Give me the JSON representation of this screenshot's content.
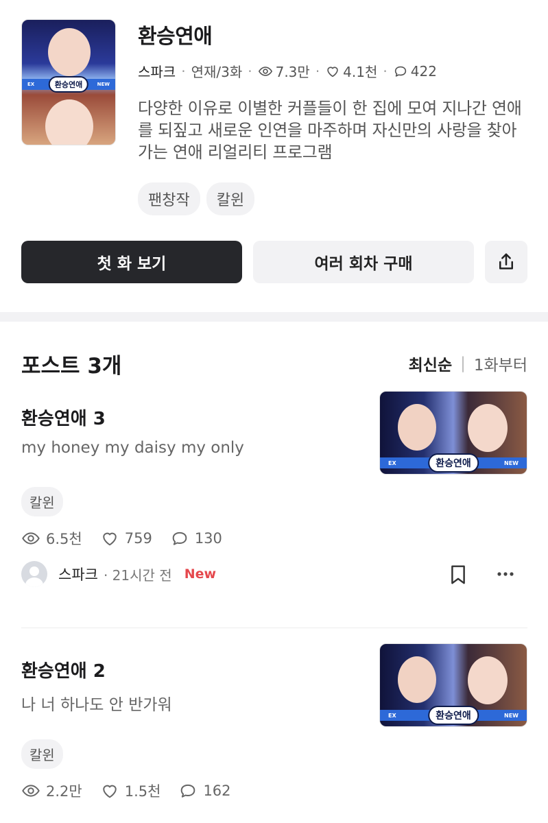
{
  "series": {
    "title": "환승연애",
    "author": "스파크",
    "status": "연재/3화",
    "views": "7.3만",
    "likes": "4.1천",
    "comments": "422",
    "description": "다양한 이유로 이별한 커플들이 한 집에 모여 지나간 연애를 되짚고 새로운 인연을 마주하며 자신만의 사랑을 찾아가는 연애 리얼리티 프로그램",
    "tags": [
      "팬창작",
      "칼윈"
    ],
    "cover_logo": "환승연애",
    "cover_band_left": "EX",
    "cover_band_right": "NEW"
  },
  "actions": {
    "first_episode": "첫 화 보기",
    "buy_multiple": "여러 회차 구매",
    "share_icon": "share-icon"
  },
  "posts_section": {
    "title": "포스트 3개",
    "sort_latest": "최신순",
    "sort_from_first": "1화부터"
  },
  "posts": [
    {
      "title": "환승연애 3",
      "subtitle": "my honey my daisy my only",
      "tag": "칼윈",
      "views": "6.5천",
      "likes": "759",
      "comments": "130",
      "author": "스파크",
      "time": "· 21시간 전",
      "badge": "New",
      "thumb_logo": "환승연애",
      "thumb_band_left": "EX",
      "thumb_band_right": "NEW"
    },
    {
      "title": "환승연애 2",
      "subtitle": "나 너 하나도 안 반가워",
      "tag": "칼윈",
      "views": "2.2만",
      "likes": "1.5천",
      "comments": "162",
      "thumb_logo": "환승연애",
      "thumb_band_left": "EX",
      "thumb_band_right": "NEW"
    }
  ],
  "colors": {
    "primary_button": "#26272b",
    "secondary_button": "#f2f2f4",
    "new_badge": "#e5484d",
    "cover_band": "#2d69d8"
  }
}
